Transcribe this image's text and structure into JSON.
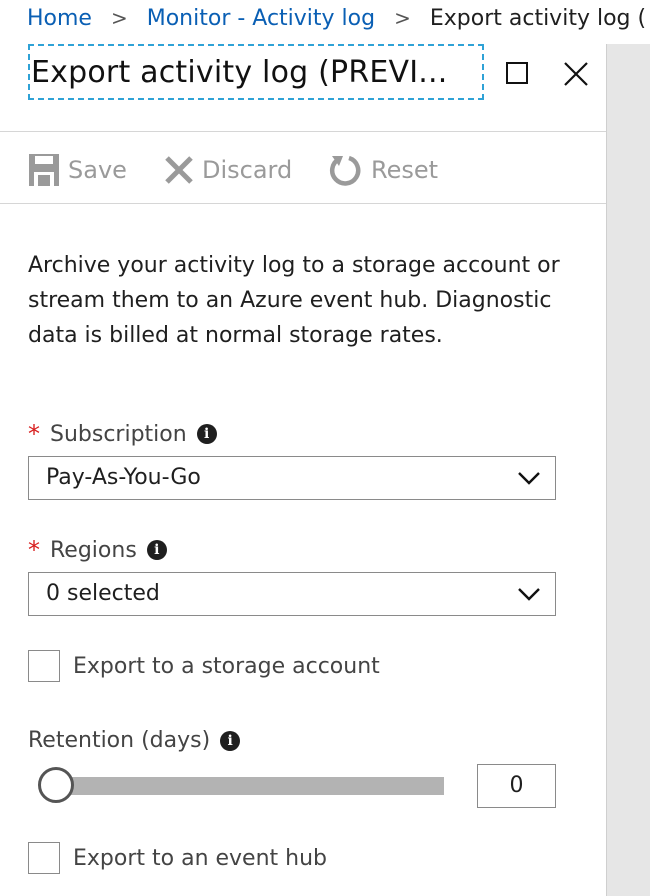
{
  "breadcrumb": {
    "items": [
      "Home",
      "Monitor - Activity log"
    ],
    "current": "Export activity log ("
  },
  "blade": {
    "title": "Export activity log (PREVI..."
  },
  "toolbar": {
    "save_label": "Save",
    "discard_label": "Discard",
    "reset_label": "Reset"
  },
  "description": "Archive your activity log to a storage account or stream them to an Azure event hub. Diagnostic data is billed at normal storage rates.",
  "form": {
    "subscription": {
      "required_mark": "*",
      "label": "Subscription",
      "value": "Pay-As-You-Go"
    },
    "regions": {
      "required_mark": "*",
      "label": "Regions",
      "value": "0 selected"
    },
    "export_storage": {
      "label": "Export to a storage account",
      "checked": false
    },
    "retention": {
      "label": "Retention (days)",
      "value": "0",
      "slider_fraction": 0
    },
    "export_event_hub": {
      "label": "Export to an event hub",
      "checked": false
    }
  },
  "colors": {
    "link": "#0a5fb4",
    "required": "#d81e1e",
    "focus_border": "#2fa2d6"
  },
  "icons": [
    "chevron-right-icon",
    "maximize-icon",
    "close-icon",
    "save-icon",
    "discard-icon",
    "reset-icon",
    "info-icon",
    "chevron-down-icon"
  ]
}
